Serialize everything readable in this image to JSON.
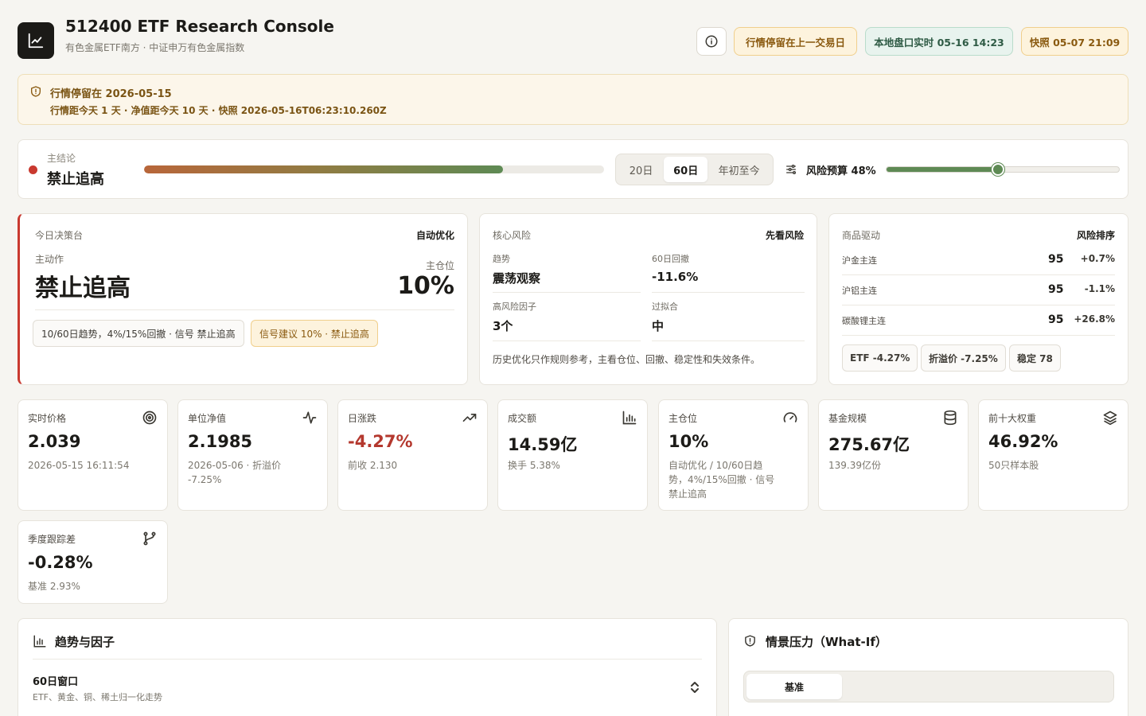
{
  "header": {
    "title": "512400 ETF Research Console",
    "subtitle": "有色金属ETF南方 · 中证申万有色金属指数",
    "pills": {
      "stale": "行情停留在上一交易日",
      "local": "本地盘口实时 05-16 14:23",
      "snapshot": "快照 05-07 21:09"
    }
  },
  "banner": {
    "title": "行情停留在 2026-05-15",
    "detail": "行情距今天 1 天 · 净值距今天 10 天 · 快照 2026-05-16T06:23:10.260Z"
  },
  "conclusion": {
    "label": "主结论",
    "value": "禁止追高",
    "progress_pct": 78,
    "periods": [
      "20日",
      "60日",
      "年初至今"
    ],
    "active_period": "60日",
    "risk_budget_label": "风险预算 48%",
    "risk_budget_pct": 48
  },
  "decision": {
    "header": "今日决策台",
    "mode": "自动优化",
    "action_label": "主动作",
    "action": "禁止追高",
    "position_label": "主仓位",
    "position": "10%",
    "chip_rule": "10/60日趋势，4%/15%回撤 · 信号 禁止追高",
    "chip_signal": "信号建议 10% · 禁止追高"
  },
  "core_risk": {
    "header": "核心风险",
    "header_right": "先看风险",
    "trend_label": "趋势",
    "trend_value": "震荡观察",
    "drawdown_label": "60日回撤",
    "drawdown_value": "-11.6%",
    "factor_label": "高风险因子",
    "factor_value": "3个",
    "overfit_label": "过拟合",
    "overfit_value": "中",
    "note": "历史优化只作规则参考，主看仓位、回撤、稳定性和失效条件。"
  },
  "commodity": {
    "header": "商品驱动",
    "header_right": "风险排序",
    "rows": [
      {
        "name": "沪金主连",
        "score": "95",
        "change": "+0.7%"
      },
      {
        "name": "沪铝主连",
        "score": "95",
        "change": "-1.1%"
      },
      {
        "name": "碳酸锂主连",
        "score": "95",
        "change": "+26.8%"
      }
    ],
    "tags": [
      "ETF -4.27%",
      "折溢价 -7.25%",
      "稳定 78"
    ]
  },
  "metrics": [
    {
      "label": "实时价格",
      "value": "2.039",
      "sub": "2026-05-15 16:11:54",
      "icon": "target-icon"
    },
    {
      "label": "单位净值",
      "value": "2.1985",
      "sub": "2026-05-06 · 折溢价 -7.25%",
      "icon": "pulse-icon"
    },
    {
      "label": "日涨跌",
      "value": "-4.27%",
      "sub": "前收 2.130",
      "icon": "trending-up-icon"
    },
    {
      "label": "成交额",
      "value": "14.59亿",
      "sub": "换手 5.38%",
      "icon": "bar-chart-icon"
    },
    {
      "label": "主仓位",
      "value": "10%",
      "sub": "自动优化 / 10/60日趋势，4%/15%回撤 · 信号 禁止追高",
      "icon": "gauge-icon"
    },
    {
      "label": "基金规模",
      "value": "275.67亿",
      "sub": "139.39亿份",
      "icon": "database-icon"
    },
    {
      "label": "前十大权重",
      "value": "46.92%",
      "sub": "50只样本股",
      "icon": "layers-icon"
    },
    {
      "label": "季度跟踪差",
      "value": "-0.28%",
      "sub": "基准 2.93%",
      "icon": "git-branch-icon"
    }
  ],
  "trend": {
    "title": "趋势与因子",
    "window_title": "60日窗口",
    "window_sub": "ETF、黄金、铜、稀土归一化走势"
  },
  "scenario": {
    "title": "情景压力（What-If）",
    "tab_active": "基准"
  },
  "colors": {
    "accent_red": "#c9392f",
    "accent_green": "#5e8a54",
    "warn_bg": "#fdf3dd",
    "negative_text": "#b4382e"
  }
}
